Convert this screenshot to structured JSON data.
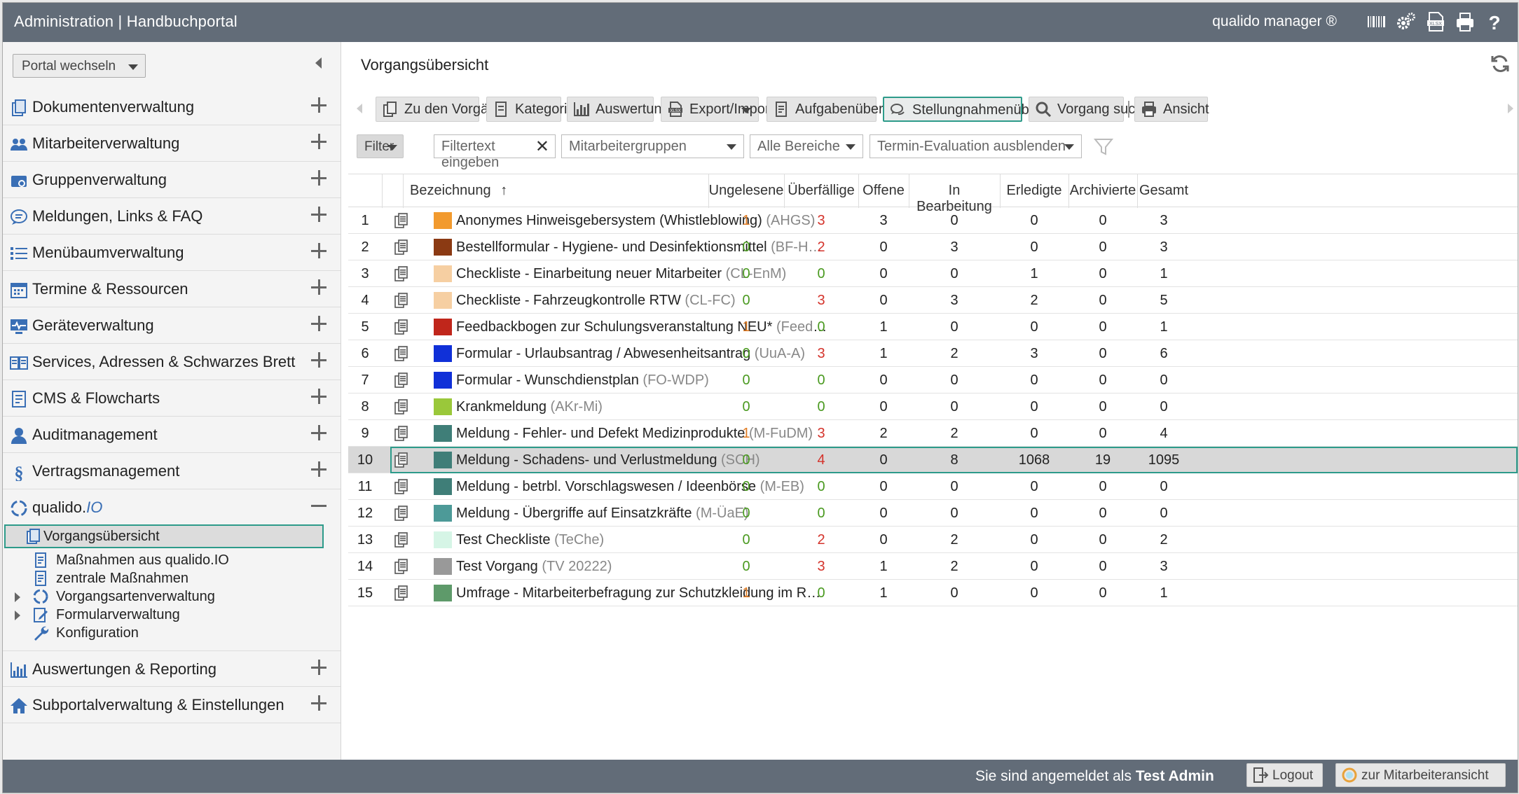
{
  "header": {
    "title": "Administration | Handbuchportal",
    "brand": "qualido manager ®",
    "icons": [
      "barcode-icon",
      "settings-gears-icon",
      "xlsx-export-icon",
      "print-icon",
      "help-icon"
    ]
  },
  "sidebar": {
    "portal_select": "Portal wechseln",
    "items": [
      {
        "label": "Dokumentenverwaltung",
        "icon": "document-icon"
      },
      {
        "label": "Mitarbeiterverwaltung",
        "icon": "users-icon"
      },
      {
        "label": "Gruppenverwaltung",
        "icon": "group-icon"
      },
      {
        "label": "Meldungen, Links & FAQ",
        "icon": "chat-icon"
      },
      {
        "label": "Menübaumverwaltung",
        "icon": "list-icon"
      },
      {
        "label": "Termine & Ressourcen",
        "icon": "calendar-icon"
      },
      {
        "label": "Geräteverwaltung",
        "icon": "monitor-icon"
      },
      {
        "label": "Services, Adressen & Schwarzes Brett",
        "icon": "book-icon"
      },
      {
        "label": "CMS & Flowcharts",
        "icon": "cms-icon"
      },
      {
        "label": "Auditmanagement",
        "icon": "auditor-icon"
      },
      {
        "label": "Vertragsmanagement",
        "icon": "paragraph-icon"
      }
    ],
    "qualido": {
      "label_main": "qualido.",
      "label_io": "IO"
    },
    "sub_items": [
      {
        "label": "Vorgangsübersicht"
      },
      {
        "label": "Maßnahmen aus qualido.IO"
      },
      {
        "label": "zentrale Maßnahmen"
      },
      {
        "label": "Vorgangsartenverwaltung"
      },
      {
        "label": "Formularverwaltung"
      },
      {
        "label": "Konfiguration"
      }
    ],
    "bottom_items": [
      {
        "label": "Auswertungen & Reporting",
        "icon": "chart-icon"
      },
      {
        "label": "Subportalverwaltung & Einstellungen",
        "icon": "home-icon"
      }
    ]
  },
  "main": {
    "title": "Vorgangsübersicht",
    "toolbar": [
      {
        "label": "Zu den Vorgängen",
        "icon": "documents-icon"
      },
      {
        "label": "Kategorien",
        "icon": "category-icon"
      },
      {
        "label": "Auswertungen",
        "icon": "bar-chart-icon"
      },
      {
        "label": "Export/Import",
        "icon": "xlsx-icon"
      },
      {
        "label": "Aufgabenübersicht",
        "icon": "task-icon"
      },
      {
        "label": "Stellungnahmenübersicht",
        "icon": "comments-icon"
      },
      {
        "label": "Vorgang suchen",
        "icon": "search-icon"
      },
      {
        "label": "Ansicht",
        "icon": "print-icon"
      }
    ],
    "filter": {
      "button": "Filter",
      "text_placeholder": "Filtertext eingeben",
      "groups": "Mitarbeitergruppen",
      "areas": "Alle Bereiche",
      "evaluation": "Termin-Evaluation ausblenden"
    },
    "columns": [
      "Bezeichnung",
      "Ungelesene",
      "Überfällige",
      "Offene",
      "In Bearbeitung",
      "Erledigte",
      "Archivierte",
      "Gesamt"
    ],
    "rows": [
      {
        "n": "1",
        "name": "Anonymes Hinweisgebersystem (Whistleblowing)",
        "abbr": "(AHGS)",
        "color": "#f29a2e",
        "ungelesen": "1",
        "ueberfaellig": "3",
        "offen": "3",
        "bearbeitung": "0",
        "erledigt": "0",
        "archiviert": "0",
        "gesamt": "3"
      },
      {
        "n": "2",
        "name": "Bestellformular - Hygiene- und Desinfektionsmittel",
        "abbr": "(BF-H…",
        "color": "#8b3a13",
        "ungelesen": "0",
        "ueberfaellig": "2",
        "offen": "0",
        "bearbeitung": "3",
        "erledigt": "0",
        "archiviert": "0",
        "gesamt": "3"
      },
      {
        "n": "3",
        "name": "Checkliste - Einarbeitung neuer Mitarbeiter",
        "abbr": "(CL-EnM)",
        "color": "#f6cfa2",
        "ungelesen": "0",
        "ueberfaellig": "0",
        "offen": "0",
        "bearbeitung": "0",
        "erledigt": "1",
        "archiviert": "0",
        "gesamt": "1"
      },
      {
        "n": "4",
        "name": "Checkliste - Fahrzeugkontrolle RTW",
        "abbr": "(CL-FC)",
        "color": "#f6cfa2",
        "ungelesen": "0",
        "ueberfaellig": "3",
        "offen": "0",
        "bearbeitung": "3",
        "erledigt": "2",
        "archiviert": "0",
        "gesamt": "5"
      },
      {
        "n": "5",
        "name": "Feedbackbogen zur Schulungsveranstaltung NEU*",
        "abbr": "(FeedS…",
        "color": "#c0261b",
        "ungelesen": "1",
        "ueberfaellig": "0",
        "offen": "1",
        "bearbeitung": "0",
        "erledigt": "0",
        "archiviert": "0",
        "gesamt": "1"
      },
      {
        "n": "6",
        "name": "Formular - Urlaubsantrag / Abwesenheitsantrag",
        "abbr": "(UuA-A)",
        "color": "#1030d8",
        "ungelesen": "0",
        "ueberfaellig": "3",
        "offen": "1",
        "bearbeitung": "2",
        "erledigt": "3",
        "archiviert": "0",
        "gesamt": "6"
      },
      {
        "n": "7",
        "name": "Formular - Wunschdienstplan",
        "abbr": "(FO-WDP)",
        "color": "#1030d8",
        "ungelesen": "0",
        "ueberfaellig": "0",
        "offen": "0",
        "bearbeitung": "0",
        "erledigt": "0",
        "archiviert": "0",
        "gesamt": "0"
      },
      {
        "n": "8",
        "name": "Krankmeldung",
        "abbr": "(AKr-Mi)",
        "color": "#9ac83a",
        "ungelesen": "0",
        "ueberfaellig": "0",
        "offen": "0",
        "bearbeitung": "0",
        "erledigt": "0",
        "archiviert": "0",
        "gesamt": "0"
      },
      {
        "n": "9",
        "name": "Meldung - Fehler- und Defekt Medizinprodukte",
        "abbr": "(M-FuDM)",
        "color": "#3f7e78",
        "ungelesen": "1",
        "ueberfaellig": "3",
        "offen": "2",
        "bearbeitung": "2",
        "erledigt": "0",
        "archiviert": "0",
        "gesamt": "4"
      },
      {
        "n": "10",
        "name": "Meldung - Schadens- und Verlustmeldung",
        "abbr": "(SCH)",
        "color": "#3f7e78",
        "ungelesen": "0",
        "ueberfaellig": "4",
        "offen": "0",
        "bearbeitung": "8",
        "erledigt": "1068",
        "archiviert": "19",
        "gesamt": "1095"
      },
      {
        "n": "11",
        "name": "Meldung - betrbl. Vorschlagswesen / Ideenbörse",
        "abbr": "(M-EB)",
        "color": "#3f7e78",
        "ungelesen": "0",
        "ueberfaellig": "0",
        "offen": "0",
        "bearbeitung": "0",
        "erledigt": "0",
        "archiviert": "0",
        "gesamt": "0"
      },
      {
        "n": "12",
        "name": "Meldung - Übergriffe auf Einsatzkräfte",
        "abbr": "(M-ÜaE)",
        "color": "#4d9a98",
        "ungelesen": "0",
        "ueberfaellig": "0",
        "offen": "0",
        "bearbeitung": "0",
        "erledigt": "0",
        "archiviert": "0",
        "gesamt": "0"
      },
      {
        "n": "13",
        "name": "Test Checkliste",
        "abbr": "(TeChe)",
        "color": "#d6f5e6",
        "ungelesen": "0",
        "ueberfaellig": "2",
        "offen": "0",
        "bearbeitung": "2",
        "erledigt": "0",
        "archiviert": "0",
        "gesamt": "2"
      },
      {
        "n": "14",
        "name": "Test Vorgang",
        "abbr": "(TV 20222)",
        "color": "#999999",
        "ungelesen": "0",
        "ueberfaellig": "3",
        "offen": "1",
        "bearbeitung": "2",
        "erledigt": "0",
        "archiviert": "0",
        "gesamt": "3"
      },
      {
        "n": "15",
        "name": "Umfrage - Mitarbeiterbefragung zur Schutzkleidung im R…",
        "abbr": "",
        "color": "#5e9a6a",
        "ungelesen": "1",
        "ueberfaellig": "0",
        "offen": "1",
        "bearbeitung": "0",
        "erledigt": "0",
        "archiviert": "0",
        "gesamt": "1"
      }
    ],
    "selected_row": "10"
  },
  "footer": {
    "logged_in_prefix": "Sie sind angemeldet als",
    "user": "Test Admin",
    "logout": "Logout",
    "employee_view": "zur Mitarbeiteransicht"
  },
  "colors": {
    "header_bg": "#626c78",
    "accent": "#2d9b8a",
    "icon_blue": "#3a6fb5",
    "green": "#4a9a20",
    "red": "#d4332b",
    "orange": "#e07b22"
  }
}
